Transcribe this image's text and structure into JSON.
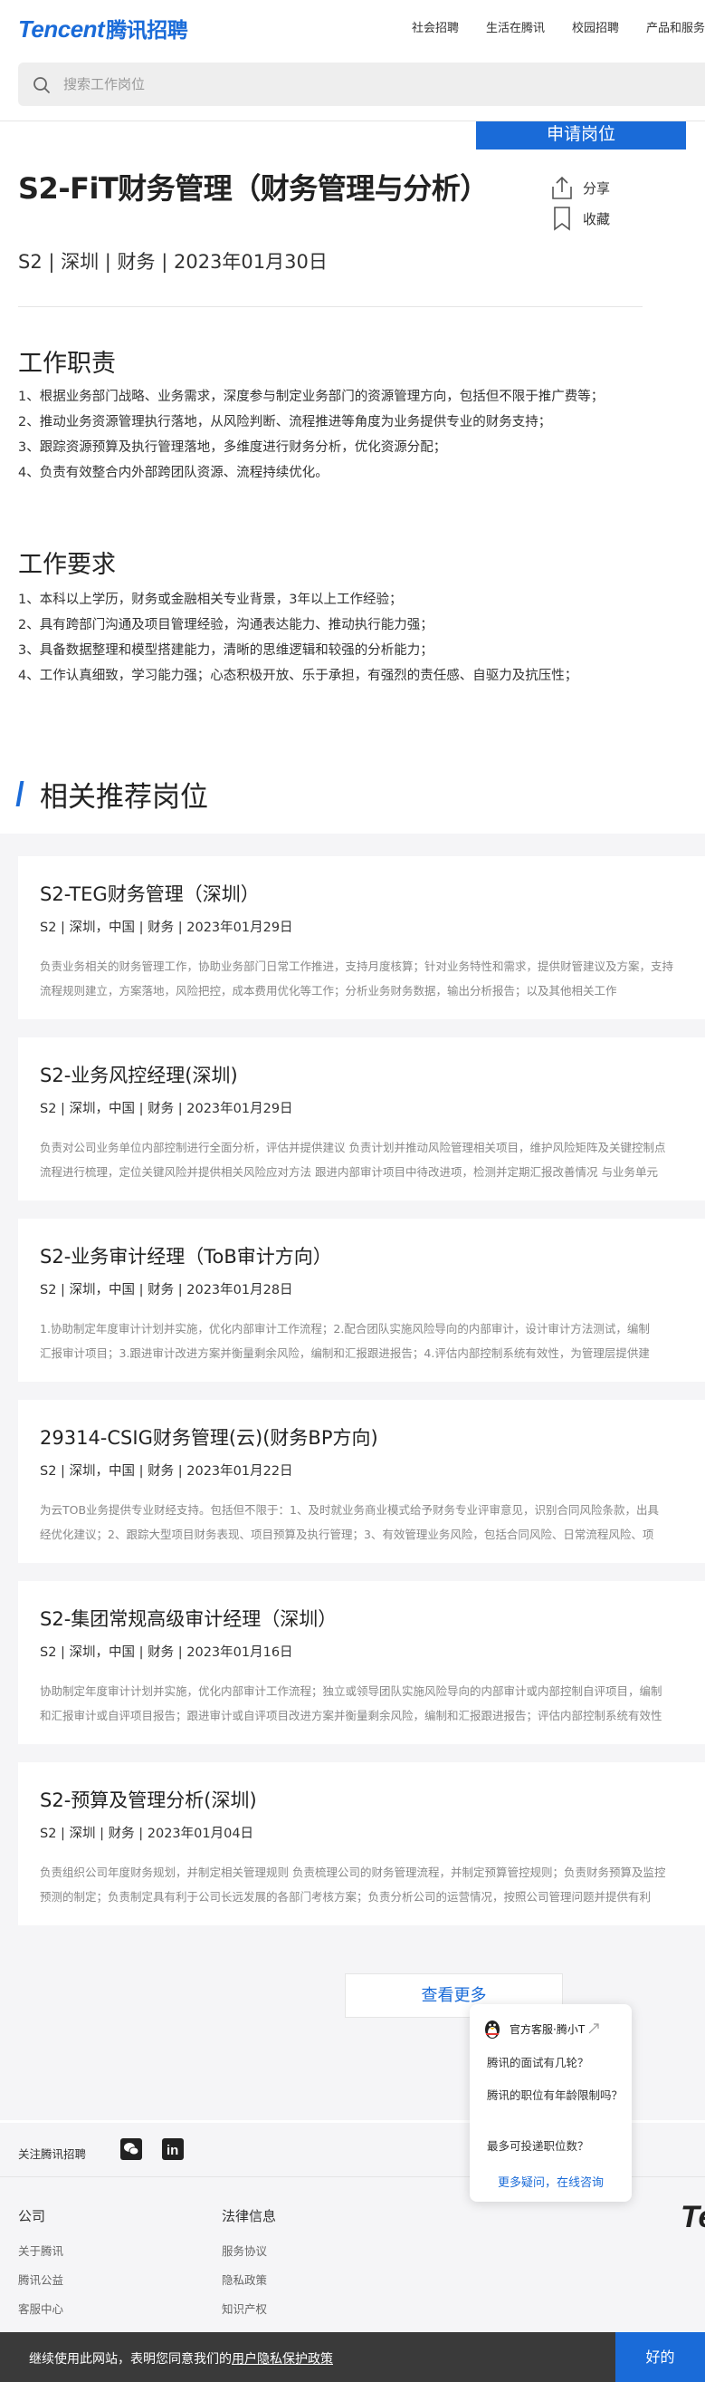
{
  "header": {
    "logo_en": "Tencent",
    "logo_cn": "腾讯招聘",
    "nav": [
      "社会招聘",
      "生活在腾讯",
      "校园招聘",
      "产品和服务"
    ],
    "search_placeholder": "搜索工作岗位"
  },
  "job": {
    "apply_label": "申请岗位",
    "title": "S2-FiT财务管理（财务管理与分析）",
    "share_label": "分享",
    "favorite_label": "收藏",
    "meta": "S2 | 深圳 | 财务 | 2023年01月30日",
    "duties_title": "工作职责",
    "duties": [
      "1、根据业务部门战略、业务需求，深度参与制定业务部门的资源管理方向，包括但不限于推广费等；",
      "2、推动业务资源管理执行落地，从风险判断、流程推进等角度为业务提供专业的财务支持；",
      "3、跟踪资源预算及执行管理落地，多维度进行财务分析，优化资源分配；",
      "4、负责有效整合内外部跨团队资源、流程持续优化。"
    ],
    "req_title": "工作要求",
    "requirements": [
      "1、本科以上学历，财务或金融相关专业背景，3年以上工作经验；",
      "2、具有跨部门沟通及项目管理经验，沟通表达能力、推动执行能力强；",
      "3、具备数据整理和模型搭建能力，清晰的思维逻辑和较强的分析能力；",
      "4、工作认真细致，学习能力强；心态积极开放、乐于承担，有强烈的责任感、自驱力及抗压性；"
    ]
  },
  "related": {
    "title": "相关推荐岗位",
    "items": [
      {
        "title": "S2-TEG财务管理（深圳）",
        "meta": "S2 | 深圳，中国 | 财务 | 2023年01月29日",
        "desc1": "负责业务相关的财务管理工作，协助业务部门日常工作推进，支持月度核算；针对业务特性和需求，提供财管建议及方案，支持",
        "desc2": "流程规则建立，方案落地，风险把控，成本费用优化等工作；分析业务财务数据，输出分析报告；以及其他相关工作"
      },
      {
        "title": "S2-业务风控经理(深圳)",
        "meta": "S2 | 深圳，中国 | 财务 | 2023年01月29日",
        "desc1": "负责对公司业务单位内部控制进行全面分析，评估并提供建议 负责计划并推动风险管理相关项目，维护风险矩阵及关键控制点",
        "desc2": "流程进行梳理，定位关键风险并提供相关风险应对方法 跟进内部审计项目中待改进项，检测并定期汇报改善情况 与业务单元"
      },
      {
        "title": "S2-业务审计经理（ToB审计方向）",
        "meta": "S2 | 深圳，中国 | 财务 | 2023年01月28日",
        "desc1": "1.协助制定年度审计计划并实施，优化内部审计工作流程；2.配合团队实施风险导向的内部审计，设计审计方法测试，编制",
        "desc2": "汇报审计项目；3.跟进审计改进方案并衡量剩余风险，编制和汇报跟进报告；4.评估内部控制系统有效性，为管理层提供建"
      },
      {
        "title": "29314-CSIG财务管理(云)(财务BP方向)",
        "meta": "S2 | 深圳，中国 | 财务 | 2023年01月22日",
        "desc1": "为云TOB业务提供专业财经支持。包括但不限于：1、及时就业务商业模式给予财务专业评审意见，识别合同风险条款，出具",
        "desc2": "经优化建议；2、跟踪大型项目财务表现、项目预算及执行管理；3、有效管理业务风险，包括合同风险、日常流程风险、项"
      },
      {
        "title": "S2-集团常规高级审计经理（深圳）",
        "meta": "S2 | 深圳，中国 | 财务 | 2023年01月16日",
        "desc1": "协助制定年度审计计划并实施，优化内部审计工作流程；独立或领导团队实施风险导向的内部审计或内部控制自评项目，编制",
        "desc2": "和汇报审计或自评项目报告；跟进审计或自评项目改进方案并衡量剩余风险，编制和汇报跟进报告；评估内部控制系统有效性"
      },
      {
        "title": "S2-预算及管理分析(深圳)",
        "meta": "S2 | 深圳 | 财务 | 2023年01月04日",
        "desc1": "负责组织公司年度财务规划，并制定相关管理规则 负责梳理公司的财务管理流程，并制定预算管控规则；负责财务预算及监控",
        "desc2": "预测的制定；负责制定具有利于公司长远发展的各部门考核方案；负责分析公司的运营情况，按照公司管理问题并提供有利"
      }
    ],
    "more_label": "查看更多"
  },
  "chat": {
    "title": "官方客服·腾小T",
    "questions": [
      "腾讯的面试有几轮？",
      "腾讯的职位有年龄限制吗？",
      "最多可投递职位数？"
    ],
    "more": "更多疑问，在线咨询"
  },
  "footer": {
    "follow_label": "关注腾讯招聘",
    "col1_title": "公司",
    "col1_links": [
      "关于腾讯",
      "腾讯公益",
      "客服中心"
    ],
    "col2_title": "法律信息",
    "col2_links": [
      "服务协议",
      "隐私政策",
      "知识产权"
    ],
    "logo_partial": "Te"
  },
  "cookie": {
    "text_prefix": "继续使用此网站，表明您同意我们的",
    "link": "用户隐私保护政策",
    "button": "好的"
  }
}
